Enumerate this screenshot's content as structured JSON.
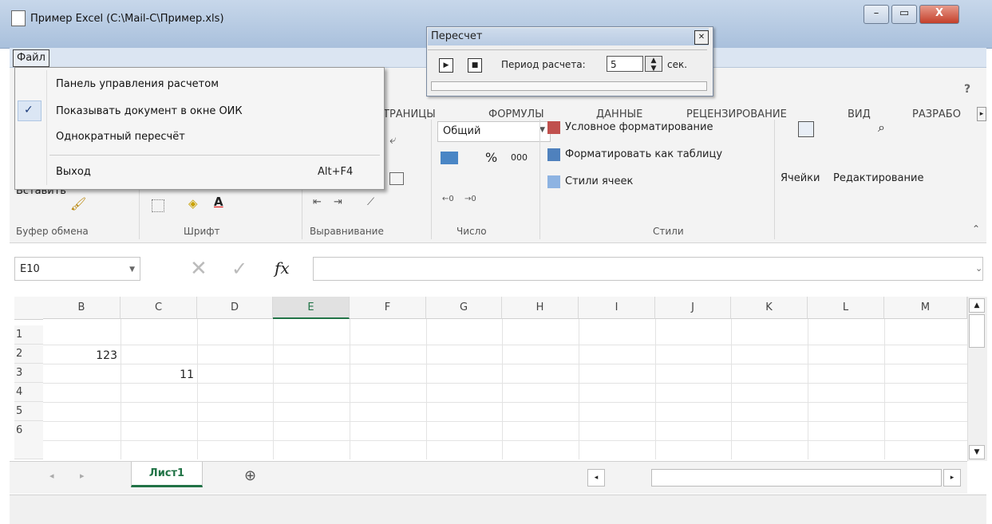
{
  "window": {
    "title": "Пример Excel (C:\\Mail-C\\Пример.xls)"
  },
  "menubar": {
    "file": "Файл"
  },
  "file_menu": {
    "items": [
      {
        "label": "Панель управления расчетом",
        "checked": false,
        "shortcut": ""
      },
      {
        "label": "Показывать документ в окне ОИК",
        "checked": true,
        "shortcut": ""
      },
      {
        "label": "Однократный пересчёт",
        "checked": false,
        "shortcut": ""
      },
      {
        "label": "Выход",
        "checked": false,
        "shortcut": "Alt+F4"
      }
    ],
    "check_glyph": "✓"
  },
  "recalc_panel": {
    "title": "Пересчет",
    "close": "✕",
    "period_label": "Период расчета:",
    "period_value": "5",
    "unit": "сек."
  },
  "ribbon": {
    "help": "?",
    "tabs": [
      "ТРАНИЦЫ",
      "ФОРМУЛЫ",
      "ДАННЫЕ",
      "РЕЦЕНЗИРОВАНИЕ",
      "ВИД",
      "РАЗРАБО"
    ],
    "paste_label": "Вставить",
    "number_format": "Общий",
    "percent": "%",
    "thousands": "000",
    "styles": {
      "conditional": "Условное форматирование",
      "as_table": "Форматировать как таблицу",
      "cell_styles": "Стили ячеек"
    },
    "cells": "Ячейки",
    "editing": "Редактирование",
    "groups": [
      "Буфер обмена",
      "Шрифт",
      "Выравнивание",
      "Число",
      "Стили"
    ]
  },
  "formula_bar": {
    "name_box": "E10",
    "fx": "fx",
    "formula": ""
  },
  "grid": {
    "columns": [
      "B",
      "C",
      "D",
      "E",
      "F",
      "G",
      "H",
      "I",
      "J",
      "K",
      "L",
      "M"
    ],
    "rows": [
      "1",
      "2",
      "3",
      "4",
      "5",
      "6"
    ],
    "active_column": "E",
    "cells": {
      "B2": "123",
      "C3": "11"
    }
  },
  "sheets": {
    "active": "Лист1",
    "add": "⊕"
  },
  "colors": {
    "accent": "#217346",
    "title_bar": "#b9cde5",
    "close_button": "#c4402b"
  }
}
